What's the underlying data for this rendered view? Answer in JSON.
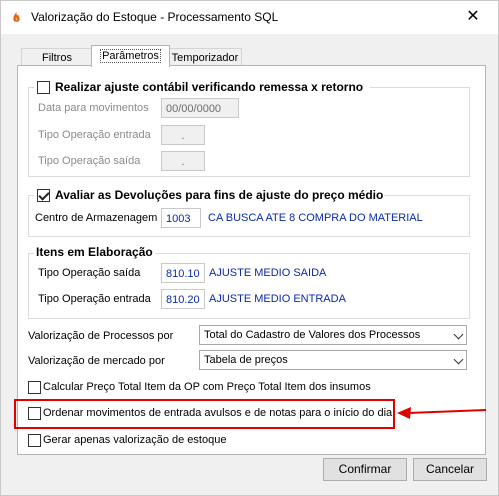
{
  "window": {
    "title": "Valorização do Estoque - Processamento SQL",
    "close_glyph": "✕",
    "app_icon": "app-flame-icon"
  },
  "tabs": [
    {
      "label": "Filtros",
      "active": false
    },
    {
      "label": "Parâmetros",
      "active": true
    },
    {
      "label": "Temporizador",
      "active": false
    }
  ],
  "ajuste": {
    "label": "Realizar ajuste contábil verificando remessa x retorno",
    "checked": false,
    "data_label": "Data para movimentos",
    "data_value": "00/00/0000",
    "entrada_label": "Tipo Operação entrada",
    "entrada_value": ".",
    "saida_label": "Tipo Operação saída",
    "saida_value": "."
  },
  "devolucoes": {
    "label": "Avaliar as Devoluções para fins de ajuste do preço médio",
    "checked": true,
    "centro_label": "Centro de Armazenagem",
    "centro_value": "1003",
    "centro_desc": "CA BUSCA ATE 8 COMPRA DO MATERIAL"
  },
  "elaboracao": {
    "title": "Itens em Elaboração",
    "saida_label": "Tipo Operação saída",
    "saida_value": "810.10",
    "saida_desc": "AJUSTE MEDIO SAIDA",
    "entrada_label": "Tipo Operação entrada",
    "entrada_value": "810.20",
    "entrada_desc": "AJUSTE MEDIO ENTRADA"
  },
  "valorizacao": {
    "processos_label": "Valorização de Processos por",
    "processos_value": "Total do Cadastro de Valores dos Processos",
    "mercado_label": "Valorização de mercado por",
    "mercado_value": "Tabela de preços"
  },
  "options": {
    "calcular_label": "Calcular Preço Total Item da OP com Preço Total Item dos insumos",
    "calcular_checked": false,
    "ordenar_label": "Ordenar movimentos de entrada avulsos e de notas para o início do dia",
    "ordenar_checked": false,
    "gerar_label": "Gerar apenas valorização de estoque",
    "gerar_checked": false
  },
  "annotation": {
    "highlight_color": "#e00000"
  },
  "buttons": {
    "confirm": "Confirmar",
    "cancel": "Cancelar"
  }
}
